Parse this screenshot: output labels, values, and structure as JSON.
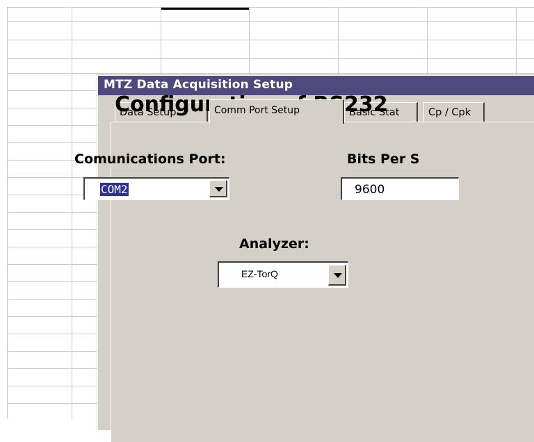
{
  "dialog": {
    "title": "MTZ Data Acquisition Setup",
    "tabs": [
      {
        "label": "Data Setup"
      },
      {
        "label": "Comm Port Setup",
        "active": true
      },
      {
        "label": "Basic Stat"
      },
      {
        "label": "Cp / Cpk"
      }
    ]
  },
  "panel": {
    "heading": "Configuration of RS232",
    "port_label": "Comunications Port:",
    "port_value": "COM2",
    "bits_label": "Bits Per S",
    "bits_value": "9600",
    "analyzer_label": "Analyzer:",
    "analyzer_value": "EZ-TorQ"
  },
  "icons": {
    "dropdown": "chevron-down-icon"
  },
  "colors": {
    "titlebar": "#4f4a7d",
    "dialog_face": "#d4d0c8",
    "selection": "#2e3190"
  }
}
